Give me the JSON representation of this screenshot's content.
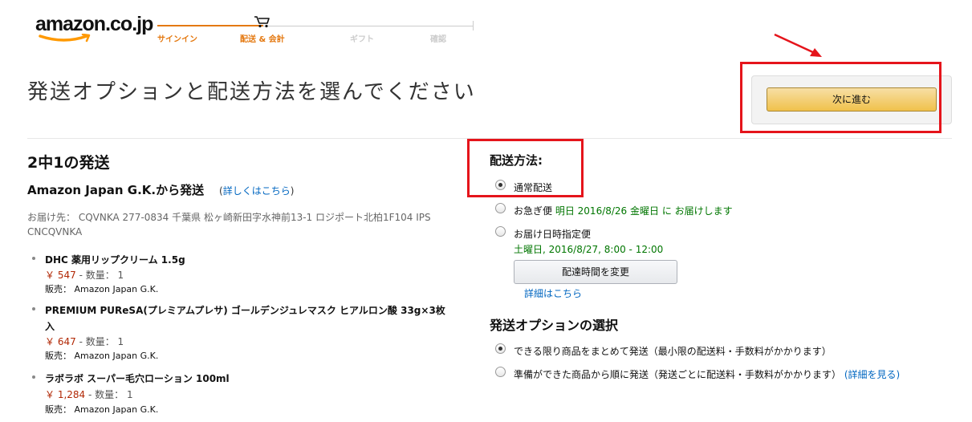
{
  "header": {
    "logo_text": "amazon.co.jp",
    "steps": [
      "サインイン",
      "配送 & 会計",
      "ギフト",
      "確認"
    ]
  },
  "page_title": "発送オプションと配送方法を選んでください",
  "continue_button": "次に進む",
  "shipment": {
    "title": "2中1の発送",
    "shipper": "Amazon Japan G.K.から発送",
    "details_prefix": "(",
    "details_link": "詳しくはこちら",
    "details_suffix": ")",
    "address_label": "お届け先：",
    "address": "CQVNKA 277-0834 千葉県 松ヶ崎新田字水神前13-1 ロジポート北柏1F104 IPS CNCQVNKA",
    "items": [
      {
        "name": "DHC 薬用リップクリーム 1.5g",
        "price": "￥ 547",
        "qty_label": "- 数量：",
        "qty": "1",
        "seller_label": "販売：",
        "seller": "Amazon Japan G.K."
      },
      {
        "name": "PREMIUM PUReSA(プレミアムプレサ) ゴールデンジュレマスク ヒアルロン酸 33g×3枚入",
        "price": "￥ 647",
        "qty_label": "- 数量：",
        "qty": "1",
        "seller_label": "販売：",
        "seller": "Amazon Japan G.K."
      },
      {
        "name": "ラボラボ スーパー毛穴ローション 100ml",
        "price": "￥ 1,284",
        "qty_label": "- 数量：",
        "qty": "1",
        "seller_label": "販売：",
        "seller": "Amazon Japan G.K."
      }
    ]
  },
  "shipping_method": {
    "title": "配送方法:",
    "options": [
      {
        "label": "通常配送",
        "selected": true
      },
      {
        "label": "お急ぎ便",
        "detail": "明日 2016/8/26 金曜日 に お届けします",
        "selected": false
      },
      {
        "label": "お届け日時指定便",
        "detail": "土曜日, 2016/8/27, 8:00 - 12:00",
        "selected": false
      }
    ],
    "change_time_button": "配達時間を変更",
    "details_link": "詳細はこちら"
  },
  "shipping_options": {
    "title": "発送オプションの選択",
    "options": [
      {
        "label": "できる限り商品をまとめて発送（最小限の配送料・手数料がかかります）",
        "selected": true
      },
      {
        "label": "準備ができた商品から順に発送（発送ごとに配送料・手数料がかかります）",
        "link": "(詳細を見る)",
        "selected": false
      }
    ]
  },
  "colors": {
    "accent_orange": "#e47911",
    "annotation_red": "#e5141b",
    "link_blue": "#0066c0",
    "price_red": "#b12704",
    "green": "#007600"
  }
}
